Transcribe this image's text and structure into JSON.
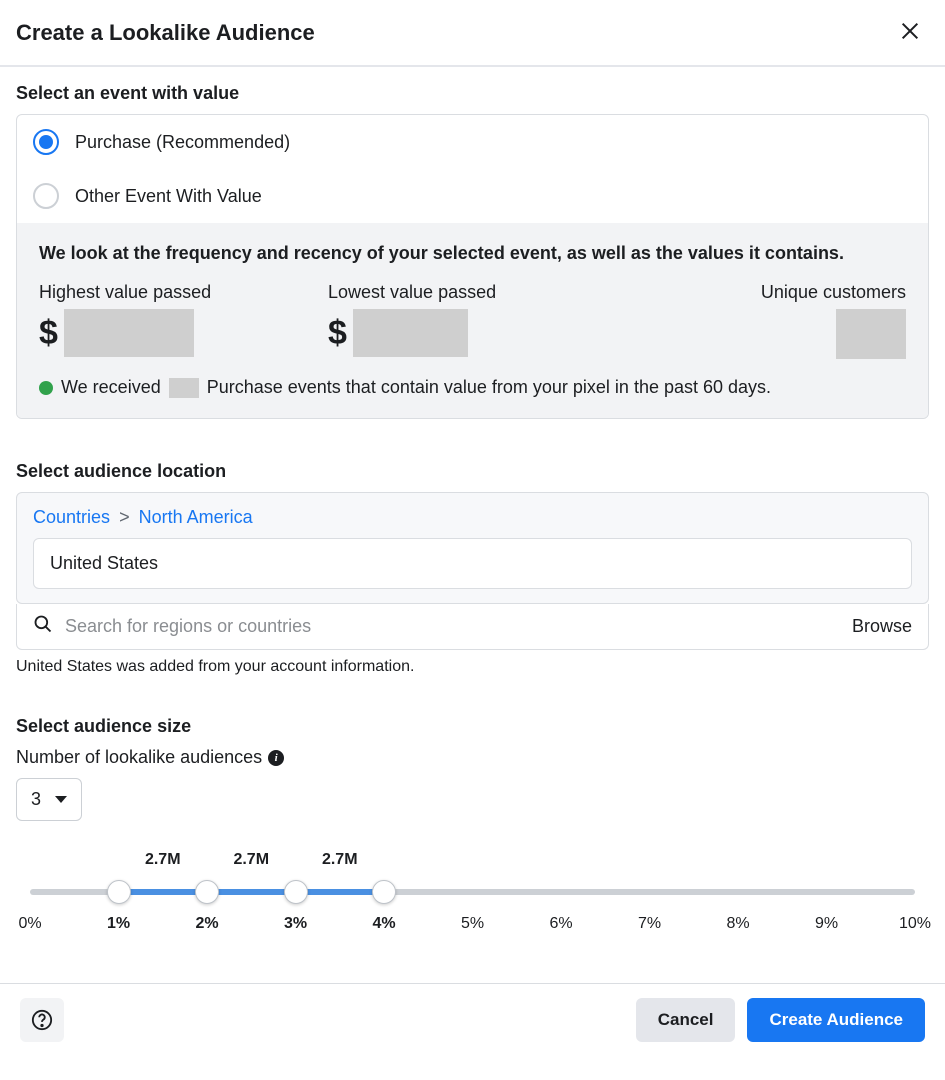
{
  "header": {
    "title": "Create a Lookalike Audience"
  },
  "event_section": {
    "title": "Select an event with value",
    "options": [
      {
        "label": "Purchase (Recommended)",
        "selected": true
      },
      {
        "label": "Other Event With Value",
        "selected": false
      }
    ],
    "info_headline": "We look at the frequency and recency of your selected event, as well as the values it contains.",
    "stats": {
      "highest_label": "Highest value passed",
      "lowest_label": "Lowest value passed",
      "unique_label": "Unique customers"
    },
    "status_prefix": "We received",
    "status_suffix": "Purchase events that contain value from your pixel in the past 60 days."
  },
  "location": {
    "title": "Select audience location",
    "breadcrumb_root": "Countries",
    "breadcrumb_region": "North America",
    "selected": "United States",
    "search_placeholder": "Search for regions or countries",
    "browse_label": "Browse",
    "hint": "United States was added from your account information."
  },
  "size": {
    "title": "Select audience size",
    "subtitle": "Number of lookalike audiences",
    "dropdown_value": "3",
    "segments": [
      {
        "pct": 1.5,
        "label": "2.7M"
      },
      {
        "pct": 2.5,
        "label": "2.7M"
      },
      {
        "pct": 3.5,
        "label": "2.7M"
      }
    ],
    "handles_pct": [
      1,
      2,
      3,
      4
    ],
    "ticks": [
      {
        "pct": 0,
        "label": "0%",
        "bold": false
      },
      {
        "pct": 1,
        "label": "1%",
        "bold": true
      },
      {
        "pct": 2,
        "label": "2%",
        "bold": true
      },
      {
        "pct": 3,
        "label": "3%",
        "bold": true
      },
      {
        "pct": 4,
        "label": "4%",
        "bold": true
      },
      {
        "pct": 5,
        "label": "5%",
        "bold": false
      },
      {
        "pct": 6,
        "label": "6%",
        "bold": false
      },
      {
        "pct": 7,
        "label": "7%",
        "bold": false
      },
      {
        "pct": 8,
        "label": "8%",
        "bold": false
      },
      {
        "pct": 9,
        "label": "9%",
        "bold": false
      },
      {
        "pct": 10,
        "label": "10%",
        "bold": false
      }
    ],
    "fill_start_pct": 1,
    "fill_end_pct": 4
  },
  "footer": {
    "cancel": "Cancel",
    "create": "Create Audience"
  }
}
